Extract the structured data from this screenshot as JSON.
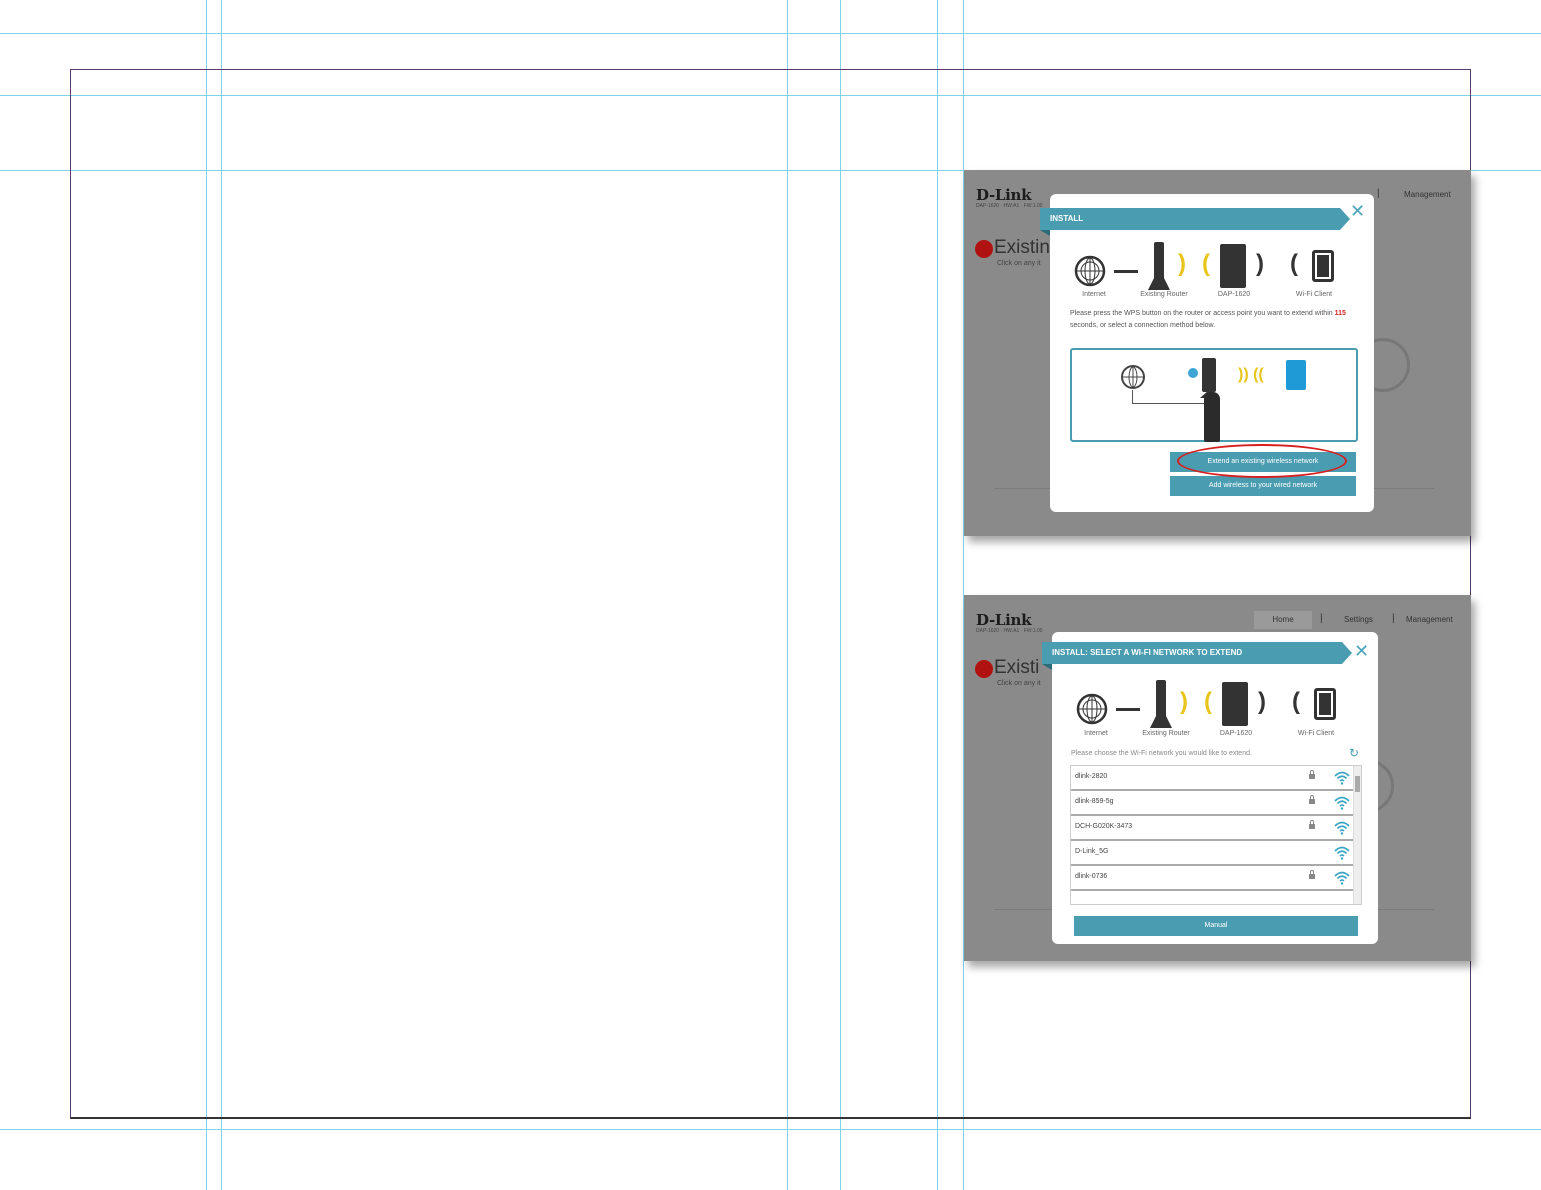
{
  "screenshot1": {
    "brand": "D-Link",
    "brand_sub": "DAP-1620 · HW:A1 · FW:1.00",
    "nav_management": "Management",
    "bg_heading": "Existin",
    "bg_sub": "Click on any it",
    "modal": {
      "title": "INSTALL",
      "diagram_labels": [
        "Internet",
        "Existing Router",
        "DAP-1620",
        "Wi-Fi Client"
      ],
      "instruction_prefix": "Please press the WPS button on the router or access point you want to extend within ",
      "countdown": "115",
      "instruction_suffix": " seconds, or select a connection method below.",
      "extend_button": "Extend an existing wireless network",
      "add_button": "Add wireless to your wired network"
    }
  },
  "screenshot2": {
    "brand": "D-Link",
    "brand_sub": "DAP-1620 · HW:A1 · FW:1.00",
    "nav_home": "Home",
    "nav_settings": "Settings",
    "nav_management": "Management",
    "bg_heading": "Existi",
    "bg_sub": "Click on any it",
    "modal": {
      "title": "INSTALL: SELECT A WI-FI NETWORK TO EXTEND",
      "diagram_labels": [
        "Internet",
        "Existing Router",
        "DAP-1620",
        "Wi-Fi Client"
      ],
      "choose_text": "Please choose the Wi-Fi network you would like to extend.",
      "networks": [
        {
          "name": "dlink-2820",
          "secured": true
        },
        {
          "name": "dlink-859-5g",
          "secured": true
        },
        {
          "name": "DCH-G020K-3473",
          "secured": true
        },
        {
          "name": "D-Link_5G",
          "secured": false
        },
        {
          "name": "dlink-0736",
          "secured": true
        }
      ],
      "manual_button": "Manual"
    }
  },
  "colors": {
    "accent": "#4a9cb0",
    "highlight": "#d62020",
    "countdown": "#d32525",
    "signal": "#e8c51c"
  }
}
